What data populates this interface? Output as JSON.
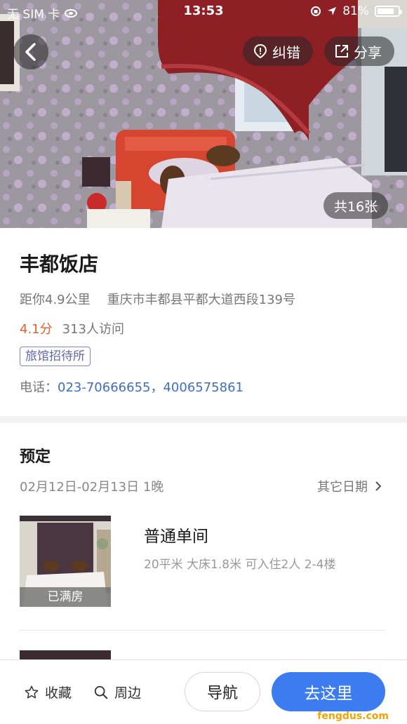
{
  "status_bar": {
    "carrier": "无 SIM 卡",
    "time": "13:53",
    "battery": "81%",
    "battery_level": 0.81
  },
  "hero": {
    "correct_label": "纠错",
    "share_label": "分享",
    "photo_count": "共16张"
  },
  "hotel": {
    "name": "丰都饭店",
    "distance": "距你4.9公里",
    "address": "重庆市丰都县平都大道西段139号",
    "rating": "4.1分",
    "visits": "313人访问",
    "category": "旅馆招待所",
    "phone_label": "电话：",
    "phone_numbers": "023-70666655，4006575861"
  },
  "booking": {
    "title": "预定",
    "date_range": "02月12日-02月13日 1晚",
    "other_dates": "其它日期",
    "rooms": [
      {
        "name": "普通单间",
        "description": "20平米 大床1.8米 可入住2人 2-4楼",
        "status": "已满房"
      }
    ]
  },
  "bottom_bar": {
    "favorite_label": "收藏",
    "nearby_label": "周边",
    "navigate_label": "导航",
    "go_label": "去这里"
  },
  "watermark": "fengdus.com",
  "colors": {
    "accent_blue": "#3c7cf0",
    "rating_orange": "#e0622e",
    "phone_blue": "#3f6fbf",
    "tag_purple": "#5e67b0"
  }
}
